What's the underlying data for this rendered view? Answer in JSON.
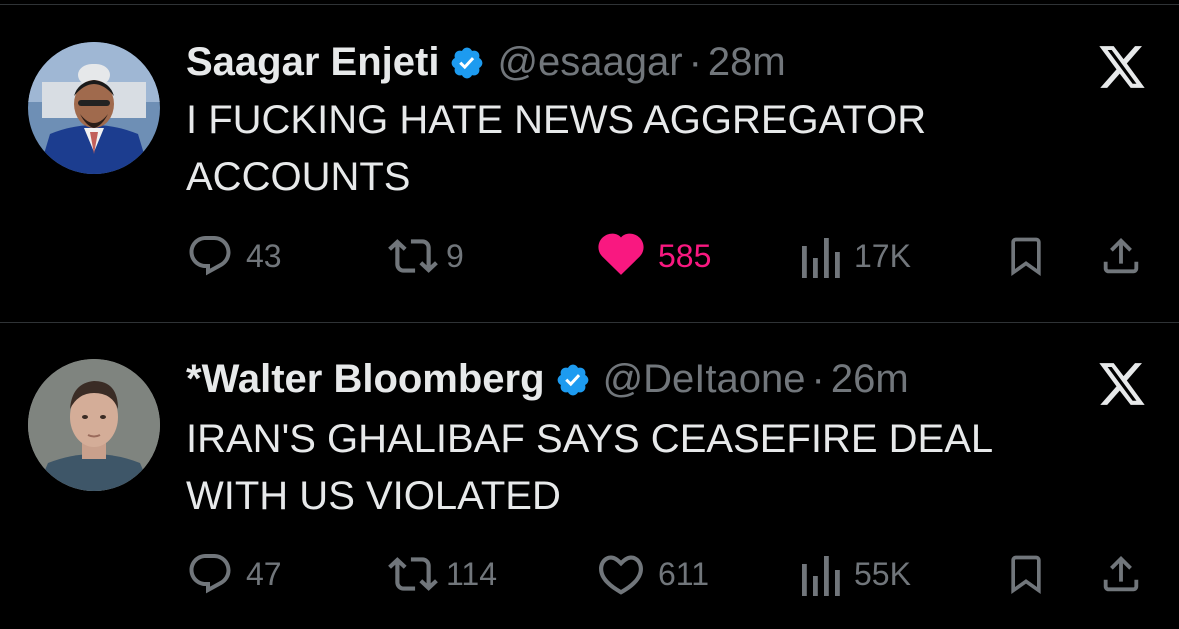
{
  "tweets": [
    {
      "display_name": "Saagar Enjeti",
      "handle": "@esaagar",
      "separator": "·",
      "time": "28m",
      "lines": [
        "I FUCKING HATE NEWS AGGREGATOR",
        "ACCOUNTS"
      ],
      "replies": "43",
      "reposts": "9",
      "likes": "585",
      "liked": true,
      "views": "17K"
    },
    {
      "display_name": "*Walter Bloomberg",
      "handle": "@DeItaone",
      "separator": "·",
      "time": "26m",
      "lines": [
        "IRAN'S GHALIBAF SAYS CEASEFIRE DEAL",
        "WITH US VIOLATED"
      ],
      "replies": "47",
      "reposts": "114",
      "likes": "611",
      "liked": false,
      "views": "55K"
    }
  ],
  "icons": {
    "verified": "verified-badge-icon",
    "close": "x-logo-icon",
    "reply": "reply-bubble-icon",
    "repost": "repost-icon",
    "like": "heart-icon",
    "views": "views-bars-icon",
    "bookmark": "bookmark-icon",
    "share": "share-icon"
  },
  "colors": {
    "background": "#000000",
    "text": "#e7e9ea",
    "muted": "#71767b",
    "divider": "#2f3336",
    "verified": "#1d9bf0",
    "like_active": "#f91880"
  }
}
